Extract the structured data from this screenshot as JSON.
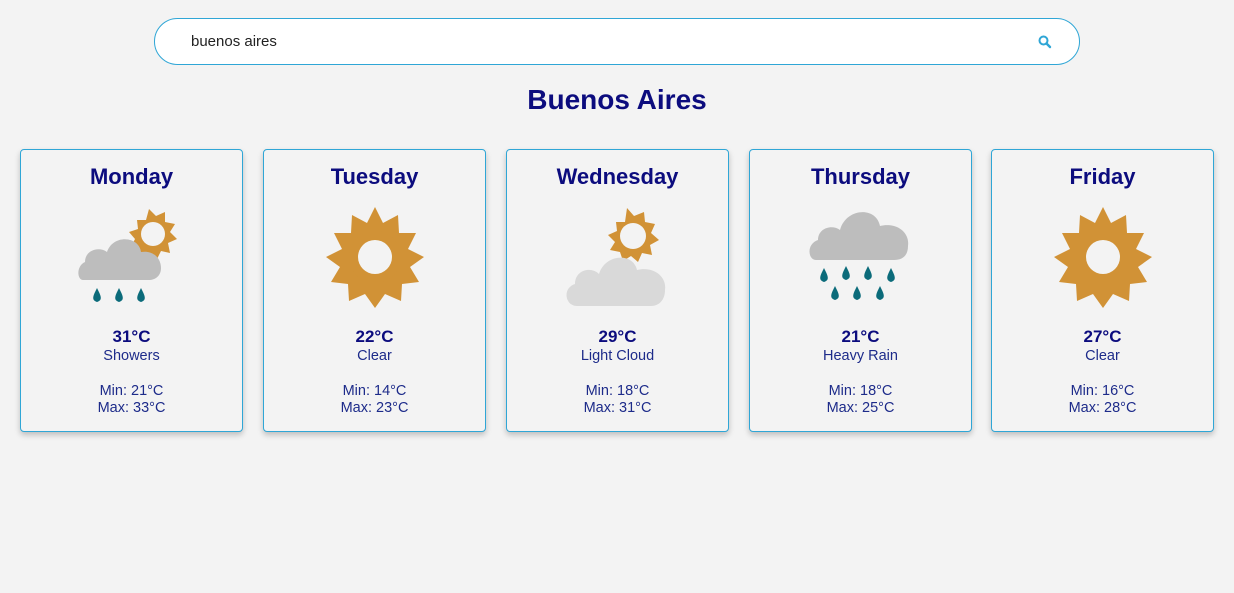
{
  "search": {
    "value": "buenos aires",
    "icon": "search-icon"
  },
  "city": "Buenos Aires",
  "colors": {
    "accent": "#2fa6d6",
    "title": "#0c0c7e",
    "text": "#1d2b8a",
    "sun": "#d19236",
    "cloud": "#bdbdbd",
    "light_cloud": "#d9d9d9",
    "rain": "#0b6b7a",
    "background": "#f3f3f3"
  },
  "forecast": [
    {
      "day": "Monday",
      "icon": "showers-icon",
      "temp": "31°C",
      "condition": "Showers",
      "min": "Min: 21°C",
      "max": "Max: 33°C"
    },
    {
      "day": "Tuesday",
      "icon": "sun-icon",
      "temp": "22°C",
      "condition": "Clear",
      "min": "Min: 14°C",
      "max": "Max: 23°C"
    },
    {
      "day": "Wednesday",
      "icon": "light-cloud-icon",
      "temp": "29°C",
      "condition": "Light Cloud",
      "min": "Min: 18°C",
      "max": "Max: 31°C"
    },
    {
      "day": "Thursday",
      "icon": "heavy-rain-icon",
      "temp": "21°C",
      "condition": "Heavy Rain",
      "min": "Min: 18°C",
      "max": "Max: 25°C"
    },
    {
      "day": "Friday",
      "icon": "sun-icon",
      "temp": "27°C",
      "condition": "Clear",
      "min": "Min: 16°C",
      "max": "Max: 28°C"
    }
  ]
}
